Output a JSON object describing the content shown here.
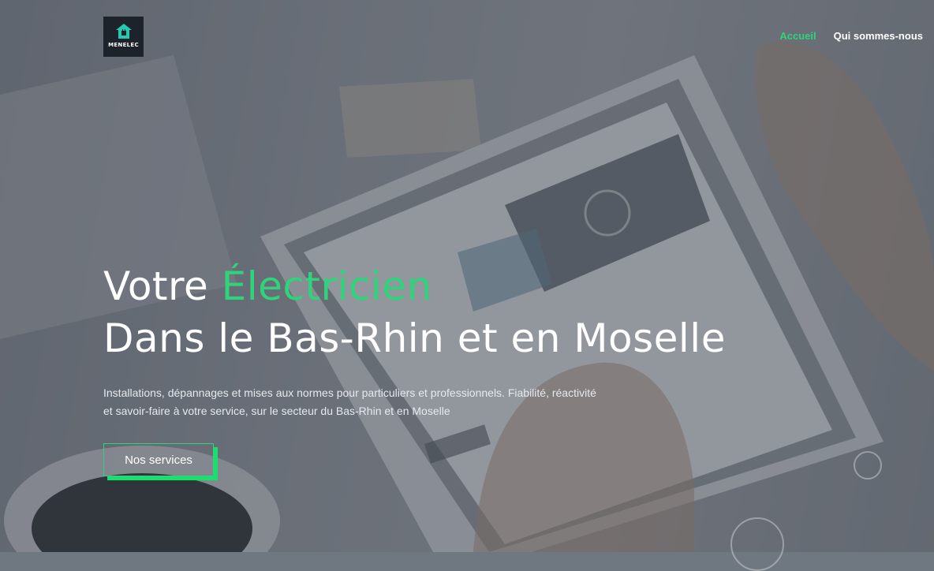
{
  "brand": {
    "name": "MENELEC"
  },
  "nav": {
    "items": [
      {
        "label": "Accueil",
        "active": true
      },
      {
        "label": "Qui sommes-nous",
        "active": false
      }
    ]
  },
  "hero": {
    "title_line1_prefix": "Votre ",
    "title_line1_accent": "Électricien",
    "title_line2": "Dans le Bas-Rhin et en Moselle",
    "description": "Installations, dépannages et mises aux normes pour particuliers et professionnels. Fiabilité, réactivité et savoir-faire à votre service, sur le secteur du Bas-Rhin et en Moselle",
    "cta_label": "Nos services"
  },
  "colors": {
    "accent": "#2fd47a",
    "cta_shadow": "#19e06c",
    "logo_bg": "#1d232b",
    "text": "#ffffff"
  },
  "icons": {
    "logo": "house-plug-icon",
    "decorative": [
      "ring-icon",
      "ring-icon"
    ]
  }
}
